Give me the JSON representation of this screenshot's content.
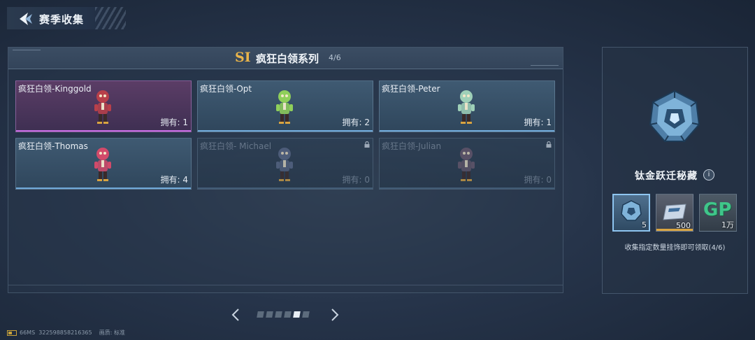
{
  "header": {
    "title": "赛季收集"
  },
  "panel": {
    "season_logo": "SI",
    "series_name": "疯狂白领系列",
    "progress": "4/6",
    "cards": [
      {
        "name": "疯狂白领-Kinggold",
        "owned": "拥有: 1",
        "rarity": "purple",
        "locked": false,
        "color": "#b8404a"
      },
      {
        "name": "疯狂白领-Opt",
        "owned": "拥有: 2",
        "rarity": "blue",
        "locked": false,
        "color": "#8fcf5a"
      },
      {
        "name": "疯狂白领-Peter",
        "owned": "拥有: 1",
        "rarity": "blue",
        "locked": false,
        "color": "#9fd0b8"
      },
      {
        "name": "疯狂白领-Thomas",
        "owned": "拥有: 4",
        "rarity": "blue",
        "locked": false,
        "color": "#d24a6a"
      },
      {
        "name": "疯狂白领- Michael",
        "owned": "拥有: 0",
        "rarity": "blue",
        "locked": true,
        "color": "#5a6a8a"
      },
      {
        "name": "疯狂白领-Julian",
        "owned": "拥有: 0",
        "rarity": "blue",
        "locked": true,
        "color": "#6a5a70"
      }
    ]
  },
  "pager": {
    "pages": 6,
    "current": 5
  },
  "reward": {
    "title": "钛金跃迁秘藏",
    "info": "i",
    "items": [
      {
        "name": "titanium-cache",
        "qty": "5"
      },
      {
        "name": "ticket",
        "qty": "500"
      },
      {
        "name": "gp-coins",
        "label": "GP",
        "qty": "1万"
      }
    ],
    "hint": "收集指定数量挂饰即可领取(4/6)"
  },
  "footer": {
    "ping": "66MS",
    "id": "322598858216365",
    "quality": "画质: 标准"
  }
}
